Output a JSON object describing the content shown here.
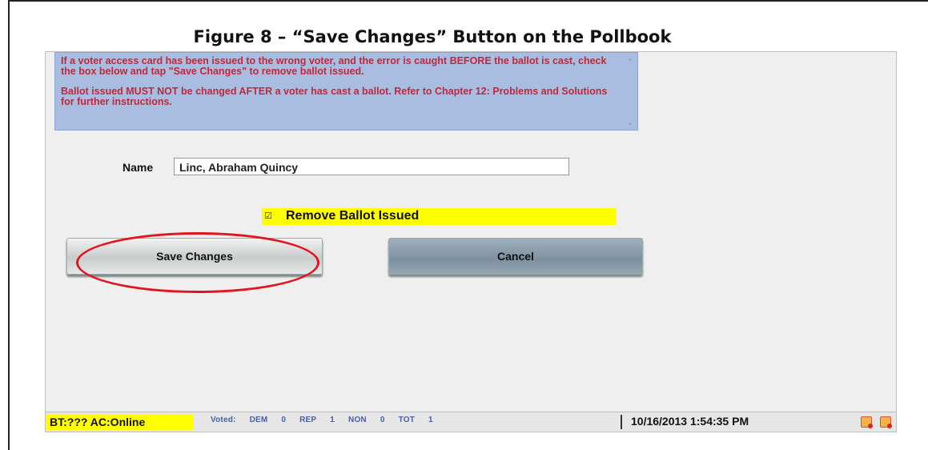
{
  "figure": {
    "title": "Figure 8 – “Save Changes” Button on the Pollbook"
  },
  "notice": {
    "paragraph1": "If a voter access card has been issued to the wrong voter, and the error is caught BEFORE the ballot is cast, check the box below and tap \"Save Changes\" to remove ballot issued.",
    "paragraph2": "Ballot issued MUST NOT be changed AFTER a voter has cast a ballot. Refer to Chapter 12: Problems and Solutions for further instructions.",
    "text_color": "#c0283c",
    "background": "#a9bde0"
  },
  "form": {
    "name_label": "Name",
    "name_value": "Linc, Abraham Quincy",
    "remove_ballot_label": "Remove Ballot Issued",
    "remove_ballot_checked": true,
    "checkbox_glyph": "☑"
  },
  "buttons": {
    "save_label": "Save Changes",
    "cancel_label": "Cancel",
    "highlight_color": "#e0151e"
  },
  "statusbar": {
    "bt_ac": "BT:??? AC:Online",
    "voted_label": "Voted:",
    "counts": [
      {
        "party": "DEM",
        "count": "0"
      },
      {
        "party": "REP",
        "count": "1"
      },
      {
        "party": "NON",
        "count": "0"
      },
      {
        "party": "TOT",
        "count": "1"
      }
    ],
    "datetime": "10/16/2013 1:54:35 PM",
    "icons": [
      "printer-alert-icon",
      "card-alert-icon"
    ]
  },
  "scroll": {
    "up_glyph": "⌃",
    "down_glyph": "⌄"
  }
}
